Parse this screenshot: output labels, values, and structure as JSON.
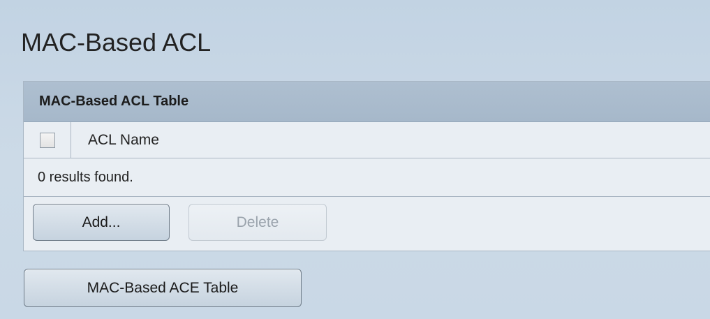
{
  "page": {
    "title": "MAC-Based ACL"
  },
  "acl_table": {
    "title": "MAC-Based ACL Table",
    "select_all_checked": false,
    "columns": [
      "ACL Name"
    ],
    "rows": [],
    "results_text": "0 results found.",
    "add_label": "Add...",
    "delete_label": "Delete",
    "delete_enabled": false
  },
  "ace_table_button": {
    "label": "MAC-Based ACE Table"
  },
  "colors": {
    "page_background": "#c9d8e6",
    "panel_header": "#a9bbcd",
    "panel_body": "#e9eef3",
    "disabled_text": "#9aa3ac"
  }
}
